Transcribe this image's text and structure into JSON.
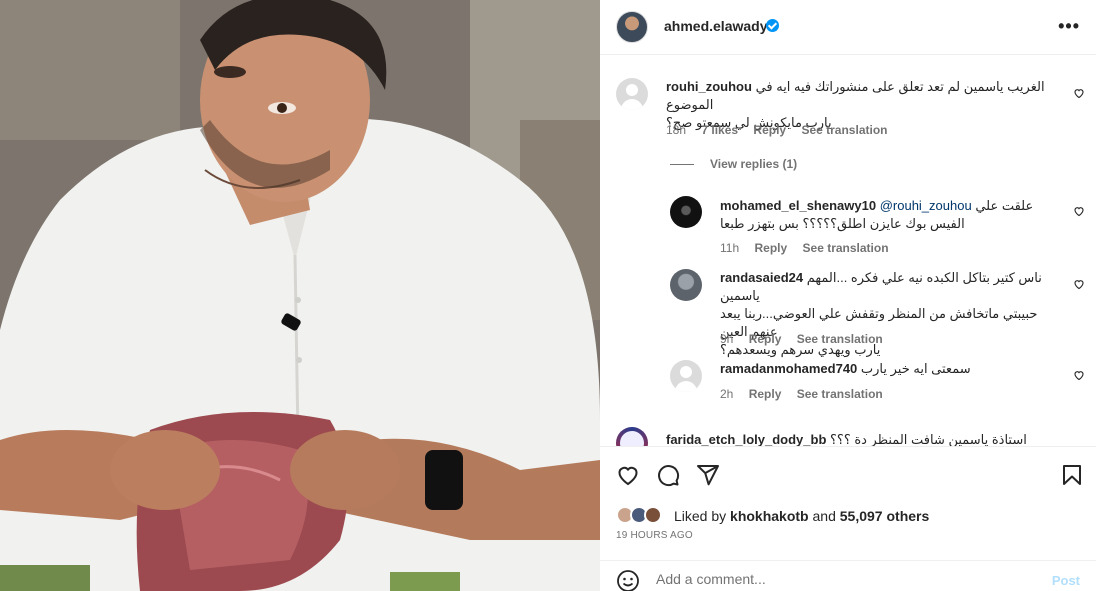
{
  "header": {
    "username": "ahmed.elawady",
    "more_icon": "more-horizontal-icon",
    "more_label": "•••"
  },
  "comments": [
    {
      "username": "rouhi_zouhou",
      "text_line1": "الغريب ياسمين لم تعد تعلق على منشوراتك فيه ايه في الموضوع",
      "text_line2": "يارب مايكونش لي سمعتو صح؟",
      "time": "18h",
      "likes": "7 likes",
      "reply": "Reply",
      "translate": "See translation"
    }
  ],
  "view_replies": "View replies (1)",
  "replies": [
    {
      "username": "mohamed_el_shenawy10",
      "mention": "@rouhi_zouhou",
      "text_line1": "علقت علي",
      "text_line2": "الفيس بوك عايزن اطلق؟؟؟؟؟ بس بتهزر طبعا",
      "time": "11h",
      "reply": "Reply",
      "translate": "See translation"
    },
    {
      "username": "randasaied24",
      "text_line1": "ناس كتير بتاكل الكبده نيه علي فكره ...المهم ياسمين",
      "text_line2": "حبيبتي ماتخافش من المنظر وتقفش علي العوضي...ربنا يبعد عنهم العين",
      "text_line3": "يارب ويهدي سرهم ويسعدهم؟",
      "time": "9h",
      "reply": "Reply",
      "translate": "See translation"
    },
    {
      "username": "ramadanmohamed740",
      "text_line1": "سمعتى ايه خير يارب",
      "time": "2h",
      "reply": "Reply",
      "translate": "See translation"
    }
  ],
  "partial_comment": {
    "username": "farida_etch_loly_dody_bb",
    "text": "استاذة ياسمين شافت المنظر دة ؟؟؟"
  },
  "actions": {
    "like_icon": "heart-icon",
    "comment_icon": "comment-icon",
    "share_icon": "send-icon",
    "save_icon": "bookmark-icon"
  },
  "likes": {
    "prefix": "Liked by",
    "user": "khokhakotb",
    "middle": "and",
    "count": "55,097 others"
  },
  "time_ago": "19 HOURS AGO",
  "add_comment": {
    "placeholder": "Add a comment...",
    "post_label": "Post"
  },
  "colors": {
    "link_blue": "#00376b",
    "verified_blue": "#0095f6",
    "muted_text": "#737373",
    "post_disabled": "#b2dffc"
  }
}
